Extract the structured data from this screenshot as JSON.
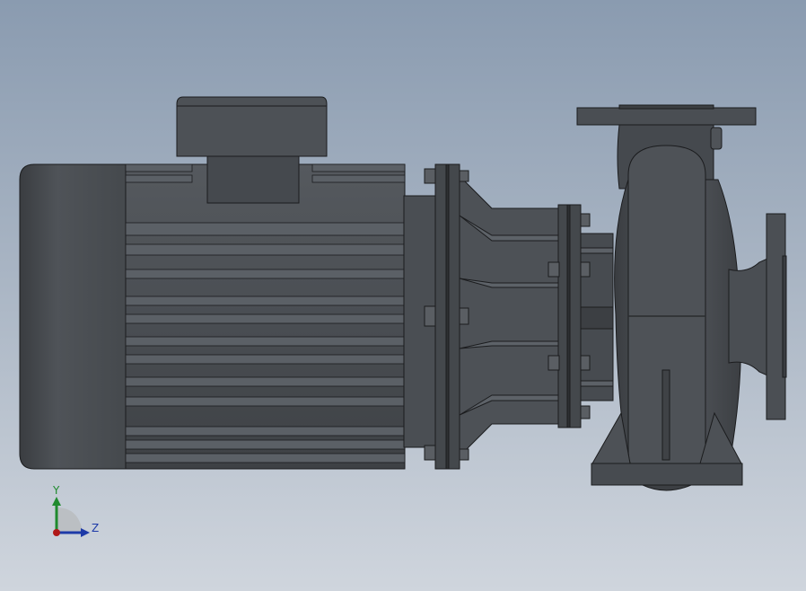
{
  "viewport": {
    "model": "centrifugal-pump-with-motor",
    "view": "side-elevation",
    "colors": {
      "background_top": "#8a9bb0",
      "background_bottom": "#cfd5dd",
      "body_dark": "#3a3d41",
      "body_mid": "#4c5055",
      "body_light": "#5c6167",
      "edge": "#1b1c1e"
    }
  },
  "triad": {
    "y_label": "Y",
    "z_label": "Z",
    "y_color": "#1f8a2e",
    "z_color": "#1d3aa8",
    "x_color": "#b01818"
  }
}
